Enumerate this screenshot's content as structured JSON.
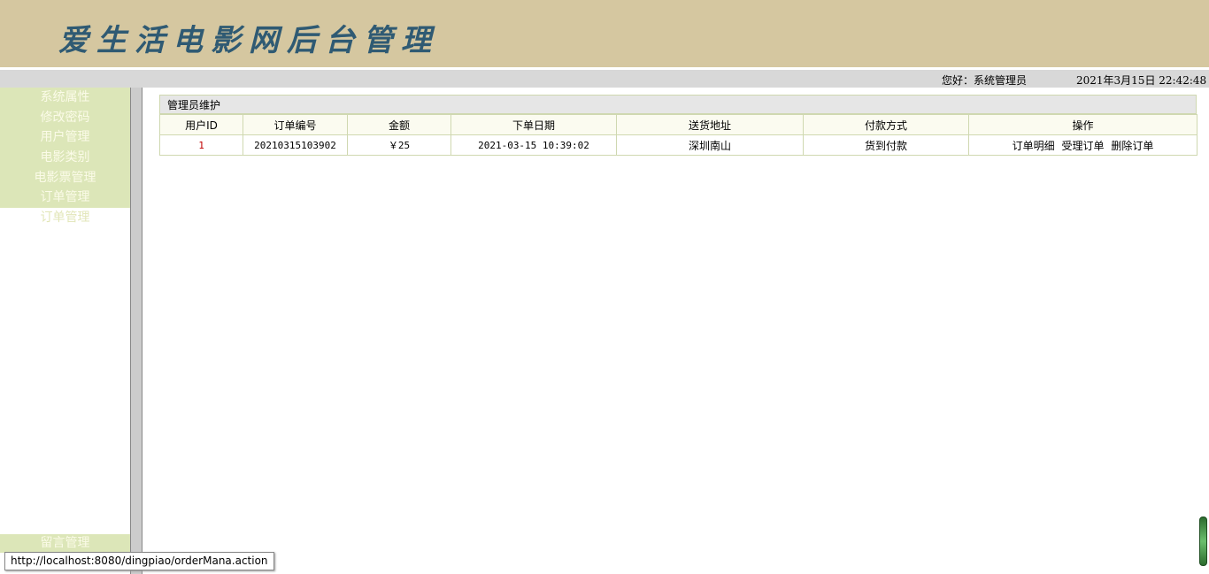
{
  "header": {
    "title": "爱生活电影网后台管理"
  },
  "infobar": {
    "greeting": "您好：系统管理员",
    "datetime": "2021年3月15日 22:42:48"
  },
  "sidebar": {
    "items": [
      {
        "label": "系统属性"
      },
      {
        "label": "修改密码"
      },
      {
        "label": "用户管理"
      },
      {
        "label": "电影类别"
      },
      {
        "label": "电影票管理"
      },
      {
        "label": "订单管理"
      }
    ],
    "sub_item": {
      "label": "订单管理"
    },
    "bottom_item": {
      "label": "留言管理"
    }
  },
  "panel": {
    "title": "管理员维护",
    "columns": [
      "用户ID",
      "订单编号",
      "金额",
      "下单日期",
      "送货地址",
      "付款方式",
      "操作"
    ],
    "rows": [
      {
        "user_id": "1",
        "order_no": "20210315103902",
        "amount": "￥25",
        "date": "2021-03-15 10:39:02",
        "address": "深圳南山",
        "payment": "货到付款",
        "actions": [
          "订单明细",
          "受理订单",
          "删除订单"
        ]
      }
    ]
  },
  "statusbar": {
    "url": "http://localhost:8080/dingpiao/orderMana.action"
  },
  "colors": {
    "banner": "#d5c7a0",
    "title": "#2f5a73",
    "sidebar": "#dce6b8",
    "border": "#cfd8b0"
  }
}
